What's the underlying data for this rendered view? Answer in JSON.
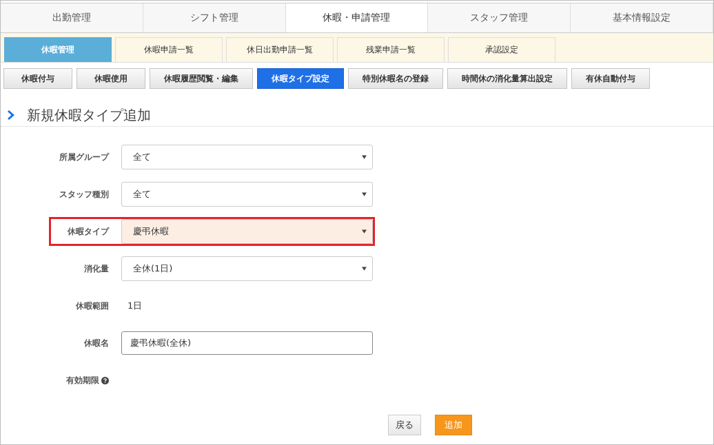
{
  "main_tabs": [
    {
      "label": "出勤管理",
      "selected": false
    },
    {
      "label": "シフト管理",
      "selected": false
    },
    {
      "label": "休暇・申請管理",
      "selected": true
    },
    {
      "label": "スタッフ管理",
      "selected": false
    },
    {
      "label": "基本情報設定",
      "selected": false
    }
  ],
  "sub_tabs": [
    {
      "label": "休暇管理",
      "selected": true
    },
    {
      "label": "休暇申請一覧",
      "selected": false
    },
    {
      "label": "休日出勤申請一覧",
      "selected": false
    },
    {
      "label": "残業申請一覧",
      "selected": false
    },
    {
      "label": "承認設定",
      "selected": false
    }
  ],
  "action_buttons": [
    {
      "label": "休暇付与",
      "selected": false
    },
    {
      "label": "休暇使用",
      "selected": false
    },
    {
      "label": "休暇履歴閲覧・編集",
      "selected": false
    },
    {
      "label": "休暇タイプ設定",
      "selected": true
    },
    {
      "label": "特別休暇名の登録",
      "selected": false
    },
    {
      "label": "時間休の消化量算出設定",
      "selected": false
    },
    {
      "label": "有休自動付与",
      "selected": false
    }
  ],
  "heading": "新規休暇タイプ追加",
  "form": [
    {
      "kind": "select",
      "label": "所属グループ",
      "value": "全て",
      "highlighted": false
    },
    {
      "kind": "select",
      "label": "スタッフ種別",
      "value": "全て",
      "highlighted": false
    },
    {
      "kind": "select",
      "label": "休暇タイプ",
      "value": "慶弔休暇",
      "highlighted": true
    },
    {
      "kind": "select",
      "label": "消化量",
      "value": "全休(1日)",
      "highlighted": false
    },
    {
      "kind": "text",
      "label": "休暇範囲",
      "value": "1日",
      "highlighted": false
    },
    {
      "kind": "input",
      "label": "休暇名",
      "value": "慶弔休暇(全休)",
      "highlighted": false
    },
    {
      "kind": "help",
      "label": "有効期限",
      "highlighted": false
    }
  ],
  "footer_buttons": [
    {
      "kind": "secondary",
      "label": "戻る"
    },
    {
      "kind": "primary",
      "label": "追加"
    }
  ]
}
